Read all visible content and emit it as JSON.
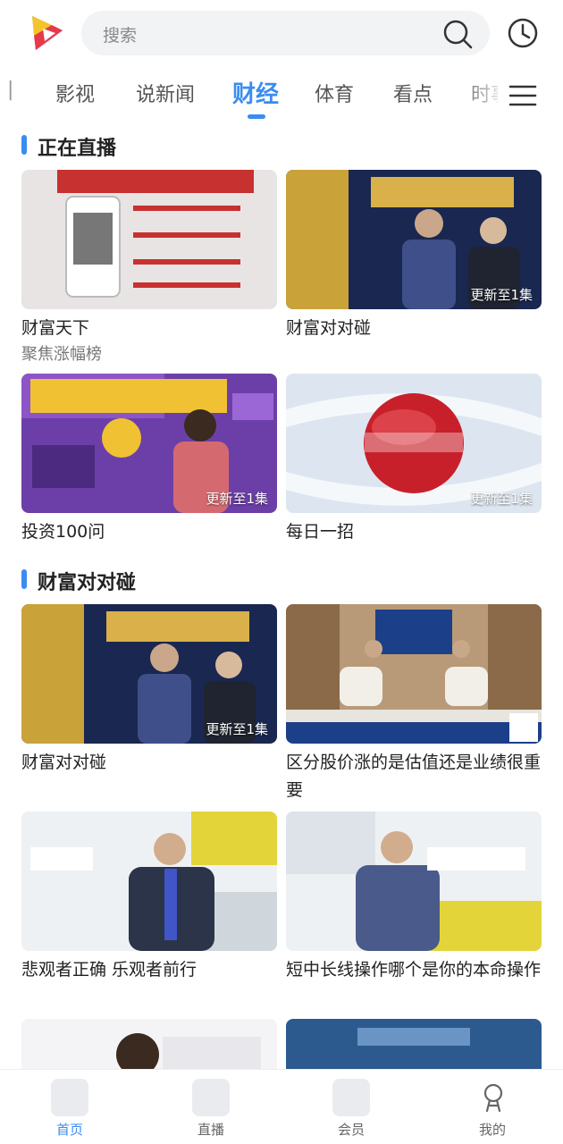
{
  "search": {
    "placeholder": "搜索"
  },
  "tabs": [
    {
      "label": "影视"
    },
    {
      "label": "说新闻"
    },
    {
      "label": "财经"
    },
    {
      "label": "体育"
    },
    {
      "label": "看点"
    },
    {
      "label": "时事"
    }
  ],
  "sections": [
    {
      "title": "正在直播",
      "cards": [
        {
          "title": "财富天下",
          "subtitle": "聚焦涨幅榜",
          "badge": ""
        },
        {
          "title": "财富对对碰",
          "subtitle": "",
          "badge": "更新至1集"
        },
        {
          "title": "投资100问",
          "subtitle": "",
          "badge": "更新至1集"
        },
        {
          "title": "每日一招",
          "subtitle": "",
          "badge": "更新至1集"
        }
      ]
    },
    {
      "title": "财富对对碰",
      "cards": [
        {
          "title": "财富对对碰",
          "badge": "更新至1集"
        },
        {
          "title": "区分股价涨的是估值还是业绩很重要",
          "badge": ""
        },
        {
          "title": "悲观者正确 乐观者前行",
          "badge": ""
        },
        {
          "title": "短中长线操作哪个是你的本命操作",
          "badge": ""
        }
      ]
    }
  ],
  "bottom_nav": [
    {
      "label": "首页"
    },
    {
      "label": "直播"
    },
    {
      "label": "会员"
    },
    {
      "label": "我的"
    }
  ],
  "colors": {
    "accent": "#3a8cf0",
    "text": "#222222",
    "subtext": "#777777"
  }
}
